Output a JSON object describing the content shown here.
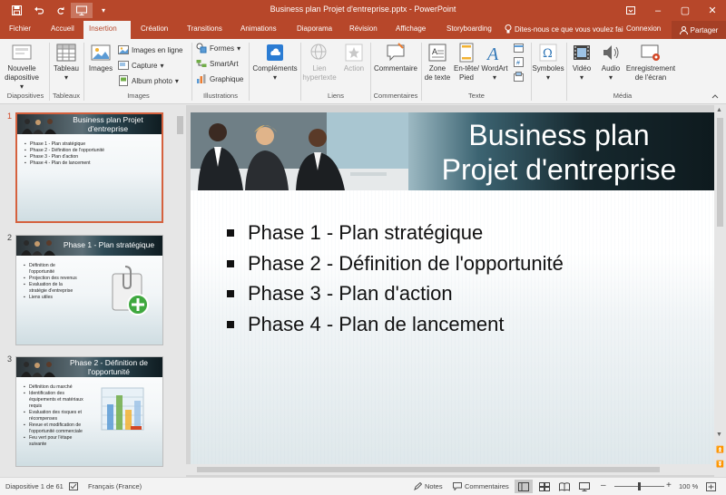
{
  "window": {
    "title": "Business plan Projet d'entreprise.pptx - PowerPoint",
    "minimize": "–",
    "maximize": "▢",
    "close": "✕"
  },
  "qat": {
    "save": "save-icon",
    "undo": "undo-icon",
    "redo": "redo-icon",
    "start": "from-beginning-icon",
    "customize": "▾"
  },
  "tabs": [
    "Fichier",
    "Accueil",
    "Insertion",
    "Création",
    "Transitions",
    "Animations",
    "Diaporama",
    "Révision",
    "Affichage",
    "Storyboarding"
  ],
  "active_tab": "Insertion",
  "tell_me": "Dites-nous ce que vous voulez fai",
  "connexion": "Connexion",
  "share": "Partager",
  "ribbon": {
    "nouvelle": "Nouvelle",
    "diapositive": "diapositive",
    "tableau": "Tableau",
    "images": "Images",
    "images_en_ligne": "Images en ligne",
    "capture": "Capture",
    "album": "Album photo",
    "formes": "Formes",
    "smartart": "SmartArt",
    "graphique": "Graphique",
    "complements": "Compléments",
    "lien": "Lien",
    "hypertexte": "hypertexte",
    "action": "Action",
    "commentaire": "Commentaire",
    "zone": "Zone",
    "de_texte": "de texte",
    "entete": "En-tête/",
    "pied": "Pied",
    "wordart": "WordArt",
    "symboles": "Symboles",
    "video": "Vidéo",
    "audio": "Audio",
    "enregistrement": "Enregistrement",
    "de_lecran": "de l'écran",
    "groups": {
      "diapositives": "Diapositives",
      "tableaux": "Tableaux",
      "images": "Images",
      "illustrations": "Illustrations",
      "liens": "Liens",
      "commentaires": "Commentaires",
      "texte": "Texte",
      "media": "Média"
    }
  },
  "thumbnails": [
    {
      "number": "1",
      "title": "Business plan Projet d'entreprise",
      "bullets": [
        "Phase 1 - Plan stratégique",
        "Phase 2 - Définition de l'opportunité",
        "Phase 3 - Plan d'action",
        "Phase 4 - Plan de lancement"
      ]
    },
    {
      "number": "2",
      "title": "Phase 1 - Plan stratégique",
      "bullets": [
        "Définition de l'opportunité",
        "Projection des revenus",
        "Evaluation de la stratégie d'entreprise",
        "Liens utiles"
      ]
    },
    {
      "number": "3",
      "title": "Phase 2 - Définition de l'opportunité",
      "bullets": [
        "Définition du marché",
        "Identification des équipements et matériaux requis",
        "Evaluation des risques et récompenses",
        "Revue et modification de l'opportunité commerciale",
        "Feu vert pour l'étape suivante"
      ]
    }
  ],
  "slide": {
    "title_line1": "Business plan",
    "title_line2": "Projet d'entreprise",
    "bullets": [
      "Phase 1 - Plan stratégique",
      "Phase 2 - Définition de l'opportunité",
      "Phase 3 - Plan d'action",
      "Phase 4 - Plan de lancement"
    ]
  },
  "status": {
    "slide_count": "Diapositive 1 de 61",
    "language": "Français (France)",
    "notes": "Notes",
    "comments": "Commentaires",
    "zoom": "100 %",
    "zoom_minus": "–",
    "zoom_plus": "+",
    "zoom_level": 0.5
  },
  "colors": {
    "accent": "#b7472a",
    "ribbon_bg": "#f3f3f3",
    "selected_thumb_border": "#d5613e"
  }
}
